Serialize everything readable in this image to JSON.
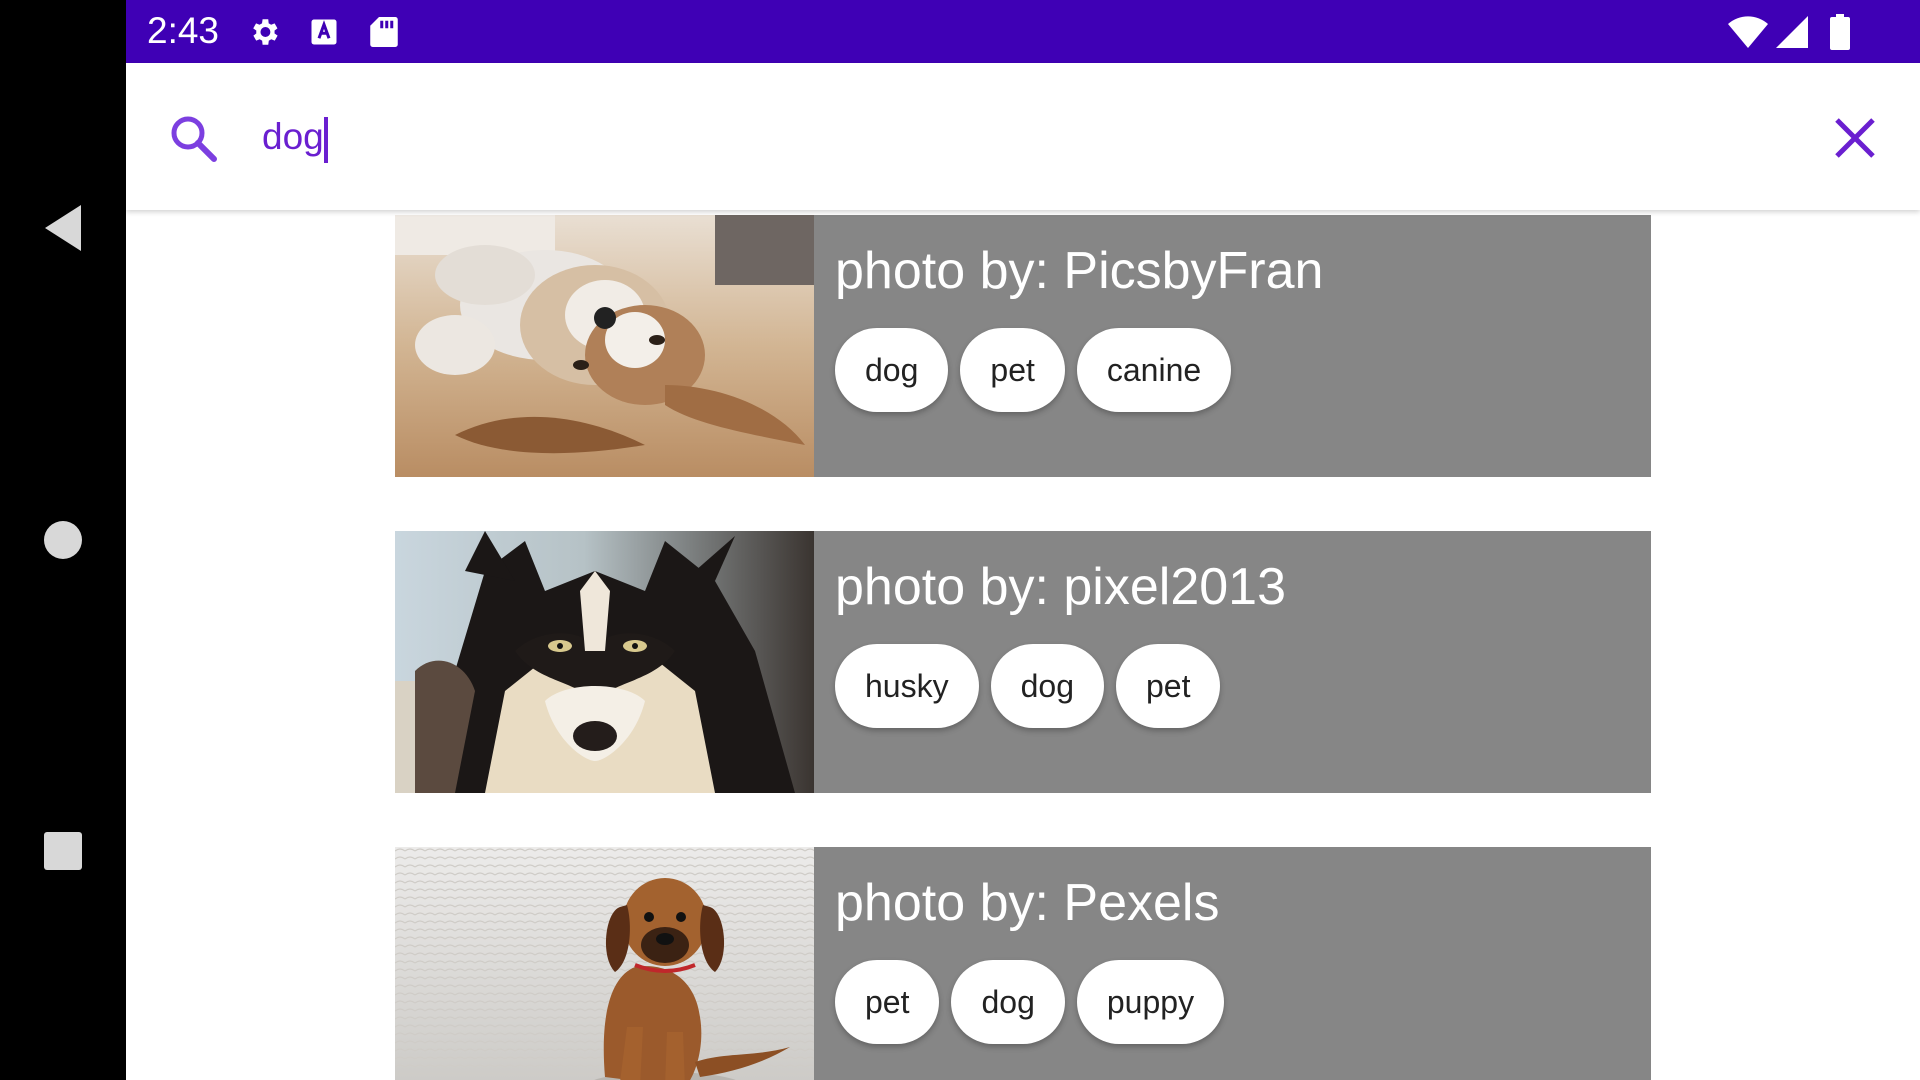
{
  "status_bar": {
    "time": "2:43",
    "icons": [
      "gear-icon",
      "text-a-icon",
      "sd-card-icon",
      "wifi-icon",
      "signal-icon",
      "battery-icon"
    ],
    "background": "#3F00B5"
  },
  "navigation": {
    "buttons": [
      "back-icon",
      "home-icon",
      "recents-icon"
    ]
  },
  "search": {
    "value": "dog",
    "accent_color": "#6A1FD0",
    "search_icon": "search-icon",
    "clear_icon": "close-icon"
  },
  "results": [
    {
      "title": "photo by: PicsbyFran",
      "tags": [
        "dog",
        "pet",
        "canine"
      ],
      "image": "shih-tzu-dog-photo"
    },
    {
      "title": "photo by: pixel2013",
      "tags": [
        "husky",
        "dog",
        "pet"
      ],
      "image": "husky-dog-photo"
    },
    {
      "title": "photo by: Pexels",
      "tags": [
        "pet",
        "dog",
        "puppy"
      ],
      "image": "puppy-dog-photo"
    }
  ],
  "colors": {
    "card_background": "#868686",
    "chip_background": "#FFFFFF"
  }
}
